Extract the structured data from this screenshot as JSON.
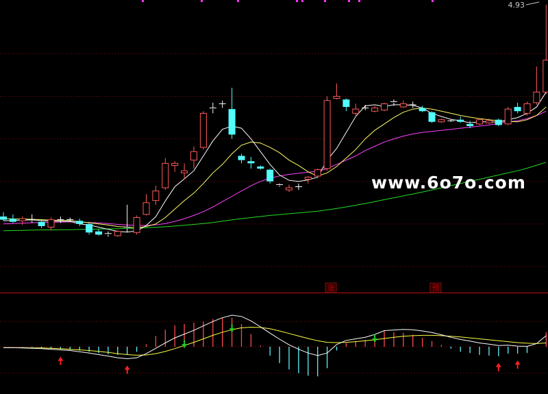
{
  "watermark": {
    "text": "www.6o7o.com"
  },
  "colors": {
    "background": "#000000",
    "grid": "#8a1010",
    "separator": "#c01010",
    "up": "#ff5a5a",
    "down": "#54fcfc",
    "doji": "#ffffff",
    "ma5": "#ffffff",
    "ma10": "#ffff66",
    "ma20": "#ff44ff",
    "ma60": "#22dd22",
    "dif": "#ffffff",
    "dea": "#ffff44",
    "macd_pos": "#ff4a4a",
    "macd_neg": "#5ef3ff",
    "arrow_up": "#ff2020",
    "arrow_down": "#22cc22"
  },
  "labels": {
    "zhang": "涨",
    "yu": "预"
  },
  "chart_data": [
    {
      "type": "candlestick",
      "price_label": "4.93",
      "ylim": [
        3.6,
        4.93
      ],
      "gridlines": [
        4.7,
        4.5,
        4.3,
        4.1,
        3.9,
        3.7
      ],
      "ohlc": [
        [
          3.935,
          3.955,
          3.915,
          3.92
        ],
        [
          3.925,
          3.945,
          3.905,
          3.91
        ],
        [
          3.915,
          3.935,
          3.895,
          3.925
        ],
        [
          3.92,
          3.945,
          3.905,
          3.915
        ],
        [
          3.91,
          3.92,
          3.88,
          3.89
        ],
        [
          3.885,
          3.93,
          3.87,
          3.92
        ],
        [
          3.92,
          3.935,
          3.905,
          3.92
        ],
        [
          3.92,
          3.93,
          3.91,
          3.92
        ],
        [
          3.915,
          3.925,
          3.89,
          3.9
        ],
        [
          3.9,
          3.91,
          3.85,
          3.86
        ],
        [
          3.865,
          3.875,
          3.845,
          3.85
        ],
        [
          3.85,
          3.865,
          3.84,
          3.855
        ],
        [
          3.845,
          3.87,
          3.84,
          3.865
        ],
        [
          3.88,
          3.99,
          3.86,
          3.885
        ],
        [
          3.86,
          3.94,
          3.85,
          3.93
        ],
        [
          3.945,
          4.04,
          3.94,
          4.0
        ],
        [
          4.01,
          4.08,
          3.99,
          4.055
        ],
        [
          4.07,
          4.21,
          4.06,
          4.185
        ],
        [
          4.175,
          4.195,
          4.145,
          4.185
        ],
        [
          4.14,
          4.185,
          4.11,
          4.15
        ],
        [
          4.2,
          4.265,
          4.16,
          4.24
        ],
        [
          4.26,
          4.43,
          4.25,
          4.42
        ],
        [
          4.44,
          4.47,
          4.42,
          4.445
        ],
        [
          4.465,
          4.48,
          4.445,
          4.465
        ],
        [
          4.44,
          4.54,
          4.3,
          4.32
        ],
        [
          4.22,
          4.23,
          4.185,
          4.2
        ],
        [
          4.195,
          4.215,
          4.16,
          4.185
        ],
        [
          4.17,
          4.175,
          4.155,
          4.16
        ],
        [
          4.155,
          4.16,
          4.09,
          4.1
        ],
        [
          4.085,
          4.09,
          4.075,
          4.08
        ],
        [
          4.06,
          4.085,
          4.05,
          4.07
        ],
        [
          4.075,
          4.09,
          4.06,
          4.075
        ],
        [
          4.11,
          4.125,
          4.09,
          4.12
        ],
        [
          4.125,
          4.16,
          4.115,
          4.155
        ],
        [
          4.16,
          4.5,
          4.15,
          4.48
        ],
        [
          4.49,
          4.56,
          4.485,
          4.5
        ],
        [
          4.485,
          4.49,
          4.43,
          4.45
        ],
        [
          4.42,
          4.465,
          4.4,
          4.44
        ],
        [
          4.445,
          4.46,
          4.435,
          4.445
        ],
        [
          4.43,
          4.455,
          4.425,
          4.445
        ],
        [
          4.435,
          4.47,
          4.43,
          4.465
        ],
        [
          4.47,
          4.485,
          4.455,
          4.475
        ],
        [
          4.45,
          4.48,
          4.445,
          4.465
        ],
        [
          4.46,
          4.475,
          4.445,
          4.455
        ],
        [
          4.445,
          4.455,
          4.425,
          4.43
        ],
        [
          4.425,
          4.43,
          4.375,
          4.38
        ],
        [
          4.38,
          4.395,
          4.375,
          4.39
        ],
        [
          4.385,
          4.39,
          4.38,
          4.385
        ],
        [
          4.39,
          4.405,
          4.375,
          4.38
        ],
        [
          4.37,
          4.385,
          4.35,
          4.36
        ],
        [
          4.37,
          4.395,
          4.365,
          4.39
        ],
        [
          4.375,
          4.395,
          4.37,
          4.385
        ],
        [
          4.39,
          4.395,
          4.36,
          4.365
        ],
        [
          4.37,
          4.45,
          4.365,
          4.44
        ],
        [
          4.45,
          4.47,
          4.42,
          4.43
        ],
        [
          4.42,
          4.475,
          4.41,
          4.465
        ],
        [
          4.47,
          4.64,
          4.46,
          4.52
        ],
        [
          4.52,
          4.93,
          4.51,
          4.67
        ]
      ],
      "ma5": [
        3.915,
        3.917,
        3.918,
        3.919,
        3.916,
        3.913,
        3.912,
        3.912,
        3.9,
        3.895,
        3.885,
        3.875,
        3.865,
        3.862,
        3.867,
        3.893,
        3.934,
        4.008,
        4.075,
        4.112,
        4.15,
        4.22,
        4.29,
        4.345,
        4.36,
        4.35,
        4.3,
        4.24,
        4.18,
        4.13,
        4.105,
        4.1,
        4.107,
        4.12,
        4.2,
        4.255,
        4.33,
        4.405,
        4.455,
        4.46,
        4.452,
        4.46,
        4.46,
        4.458,
        4.445,
        4.42,
        4.405,
        4.392,
        4.385,
        4.375,
        4.38,
        4.38,
        4.378,
        4.39,
        4.4,
        4.42,
        4.45,
        4.52
      ],
      "ma10": [
        3.925,
        3.924,
        3.923,
        3.922,
        3.92,
        3.918,
        3.917,
        3.916,
        3.91,
        3.906,
        3.9,
        3.895,
        3.888,
        3.885,
        3.882,
        3.888,
        3.9,
        3.93,
        3.97,
        4.01,
        4.045,
        4.09,
        4.14,
        4.18,
        4.23,
        4.27,
        4.285,
        4.28,
        4.26,
        4.235,
        4.2,
        4.175,
        4.145,
        4.125,
        4.14,
        4.17,
        4.21,
        4.25,
        4.3,
        4.34,
        4.37,
        4.4,
        4.425,
        4.44,
        4.445,
        4.44,
        4.43,
        4.42,
        4.41,
        4.402,
        4.395,
        4.39,
        4.385,
        4.382,
        4.38,
        4.39,
        4.41,
        4.45
      ],
      "ma20": [
        3.9,
        3.902,
        3.904,
        3.906,
        3.907,
        3.908,
        3.909,
        3.91,
        3.909,
        3.907,
        3.905,
        3.902,
        3.898,
        3.895,
        3.893,
        3.893,
        3.896,
        3.902,
        3.912,
        3.925,
        3.94,
        3.958,
        3.98,
        4.005,
        4.03,
        4.055,
        4.08,
        4.1,
        4.115,
        4.126,
        4.133,
        4.138,
        4.143,
        4.148,
        4.16,
        4.18,
        4.2,
        4.22,
        4.245,
        4.265,
        4.285,
        4.3,
        4.313,
        4.323,
        4.33,
        4.335,
        4.34,
        4.345,
        4.35,
        4.355,
        4.36,
        4.365,
        4.372,
        4.38,
        4.385,
        4.395,
        4.41,
        4.43
      ],
      "ma60": [
        3.868,
        3.869,
        3.87,
        3.871,
        3.872,
        3.872,
        3.873,
        3.873,
        3.874,
        3.875,
        3.876,
        3.877,
        3.878,
        3.879,
        3.88,
        3.882,
        3.884,
        3.887,
        3.89,
        3.894,
        3.898,
        3.902,
        3.907,
        3.913,
        3.919,
        3.925,
        3.93,
        3.935,
        3.94,
        3.944,
        3.948,
        3.952,
        3.956,
        3.96,
        3.966,
        3.973,
        3.98,
        3.988,
        3.996,
        4.005,
        4.014,
        4.023,
        4.032,
        4.041,
        4.05,
        4.06,
        4.07,
        4.08,
        4.09,
        4.1,
        4.11,
        4.12,
        4.13,
        4.14,
        4.15,
        4.162,
        4.176,
        4.19
      ]
    },
    {
      "type": "macd",
      "ylim": [
        -0.13,
        0.13
      ],
      "dif": [
        -0.003,
        -0.003,
        -0.004,
        -0.005,
        -0.006,
        -0.008,
        -0.01,
        -0.012,
        -0.016,
        -0.02,
        -0.025,
        -0.03,
        -0.035,
        -0.038,
        -0.035,
        -0.022,
        -0.005,
        0.012,
        0.028,
        0.04,
        0.052,
        0.066,
        0.08,
        0.092,
        0.1,
        0.096,
        0.082,
        0.063,
        0.043,
        0.024,
        0.006,
        -0.008,
        -0.02,
        -0.028,
        -0.02,
        0.007,
        0.02,
        0.025,
        0.03,
        0.039,
        0.051,
        0.053,
        0.055,
        0.054,
        0.05,
        0.045,
        0.038,
        0.03,
        0.023,
        0.018,
        0.012,
        0.008,
        0.004,
        0.005,
        0.002,
        0.001,
        0.01,
        0.035
      ],
      "dea": [
        -0.003,
        -0.003,
        -0.003,
        -0.004,
        -0.004,
        -0.005,
        -0.006,
        -0.008,
        -0.01,
        -0.012,
        -0.015,
        -0.018,
        -0.022,
        -0.025,
        -0.027,
        -0.026,
        -0.022,
        -0.015,
        -0.006,
        0.004,
        0.014,
        0.025,
        0.036,
        0.046,
        0.054,
        0.06,
        0.062,
        0.061,
        0.057,
        0.05,
        0.042,
        0.034,
        0.026,
        0.019,
        0.014,
        0.013,
        0.014,
        0.016,
        0.019,
        0.022,
        0.026,
        0.03,
        0.033,
        0.035,
        0.036,
        0.036,
        0.035,
        0.033,
        0.031,
        0.028,
        0.025,
        0.022,
        0.019,
        0.016,
        0.013,
        0.011,
        0.01,
        0.012
      ],
      "macd": [
        0.0,
        0.0,
        -0.001,
        -0.002,
        -0.004,
        -0.006,
        -0.008,
        -0.01,
        -0.012,
        -0.016,
        -0.02,
        -0.024,
        -0.026,
        -0.026,
        -0.016,
        0.008,
        0.034,
        0.054,
        0.068,
        0.072,
        0.076,
        0.08,
        0.088,
        0.092,
        0.092,
        0.072,
        0.04,
        0.004,
        -0.028,
        -0.052,
        -0.072,
        -0.084,
        -0.092,
        -0.094,
        -0.068,
        -0.012,
        0.012,
        0.018,
        0.022,
        0.034,
        0.05,
        0.046,
        0.044,
        0.038,
        0.028,
        0.018,
        0.006,
        -0.006,
        -0.016,
        -0.02,
        -0.026,
        -0.028,
        -0.03,
        -0.022,
        -0.022,
        -0.02,
        0.0,
        0.046
      ],
      "up_arrows": [
        6,
        13,
        52,
        54
      ],
      "down_arrows": [
        19,
        24,
        39
      ]
    }
  ]
}
